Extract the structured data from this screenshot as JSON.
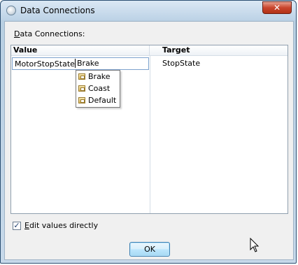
{
  "window": {
    "title": "Data Connections",
    "close_glyph": "✕"
  },
  "section": {
    "label_prefix": "D",
    "label_rest": "ata Connections:"
  },
  "table": {
    "headers": {
      "value": "Value",
      "target": "Target"
    },
    "rows": [
      {
        "value_name": "MotorStopState",
        "value_enum": "Brake",
        "target": "StopState"
      }
    ]
  },
  "dropdown": {
    "items": [
      {
        "label": "Brake",
        "icon": "enum-item-icon"
      },
      {
        "label": "Coast",
        "icon": "enum-item-icon"
      },
      {
        "label": "Default",
        "icon": "enum-item-icon"
      }
    ]
  },
  "edit_directly": {
    "checked": true,
    "label_prefix": "E",
    "label_rest": "dit values directly"
  },
  "ok_button": {
    "label": "OK"
  },
  "colors": {
    "title_bar": "#c7d9ea",
    "close_button": "#c9452d",
    "ok_button": "#bde6fd"
  }
}
